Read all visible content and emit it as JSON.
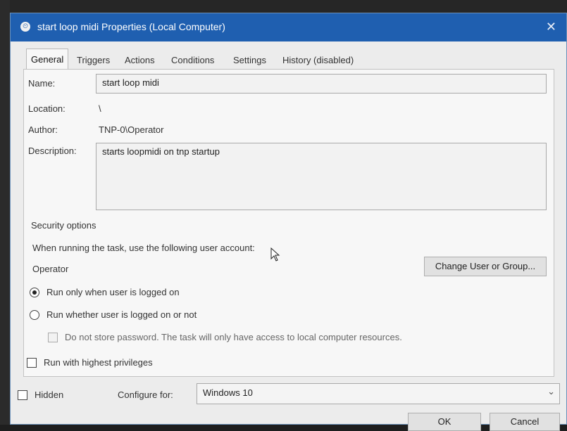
{
  "dialog": {
    "title": "start loop midi Properties (Local Computer)",
    "close_glyph": "✕",
    "title_icon_glyph": "⏲"
  },
  "tabs": [
    {
      "label": "General",
      "active": true
    },
    {
      "label": "Triggers"
    },
    {
      "label": "Actions"
    },
    {
      "label": "Conditions"
    },
    {
      "label": "Settings"
    },
    {
      "label": "History (disabled)"
    }
  ],
  "general": {
    "name_label": "Name:",
    "name_value": "start loop midi",
    "location_label": "Location:",
    "location_value": "\\",
    "author_label": "Author:",
    "author_value": "TNP-0\\Operator",
    "description_label": "Description:",
    "description_value": "starts loopmidi on tnp startup"
  },
  "security": {
    "heading": "Security options",
    "account_prompt": "When running the task, use the following user account:",
    "account_value": "Operator",
    "change_button": "Change User or Group...",
    "radio_logged_on": "Run only when user is logged on",
    "radio_logged_on_selected": true,
    "radio_whether": "Run whether user is logged on or not",
    "no_store_password": "Do not store password.  The task will only have access to local computer resources.",
    "highest_privileges": "Run with highest privileges"
  },
  "footer": {
    "hidden_label": "Hidden",
    "configure_label": "Configure for:",
    "configure_value": "Windows 10",
    "ok_button": "OK",
    "cancel_button": "Cancel"
  },
  "colors": {
    "titlebar": "#1f5fb0",
    "dialog_bg": "#ececec"
  },
  "icons": [
    "task-scheduler-icon",
    "close-icon",
    "chevron-down-icon",
    "mouse-cursor-icon"
  ]
}
